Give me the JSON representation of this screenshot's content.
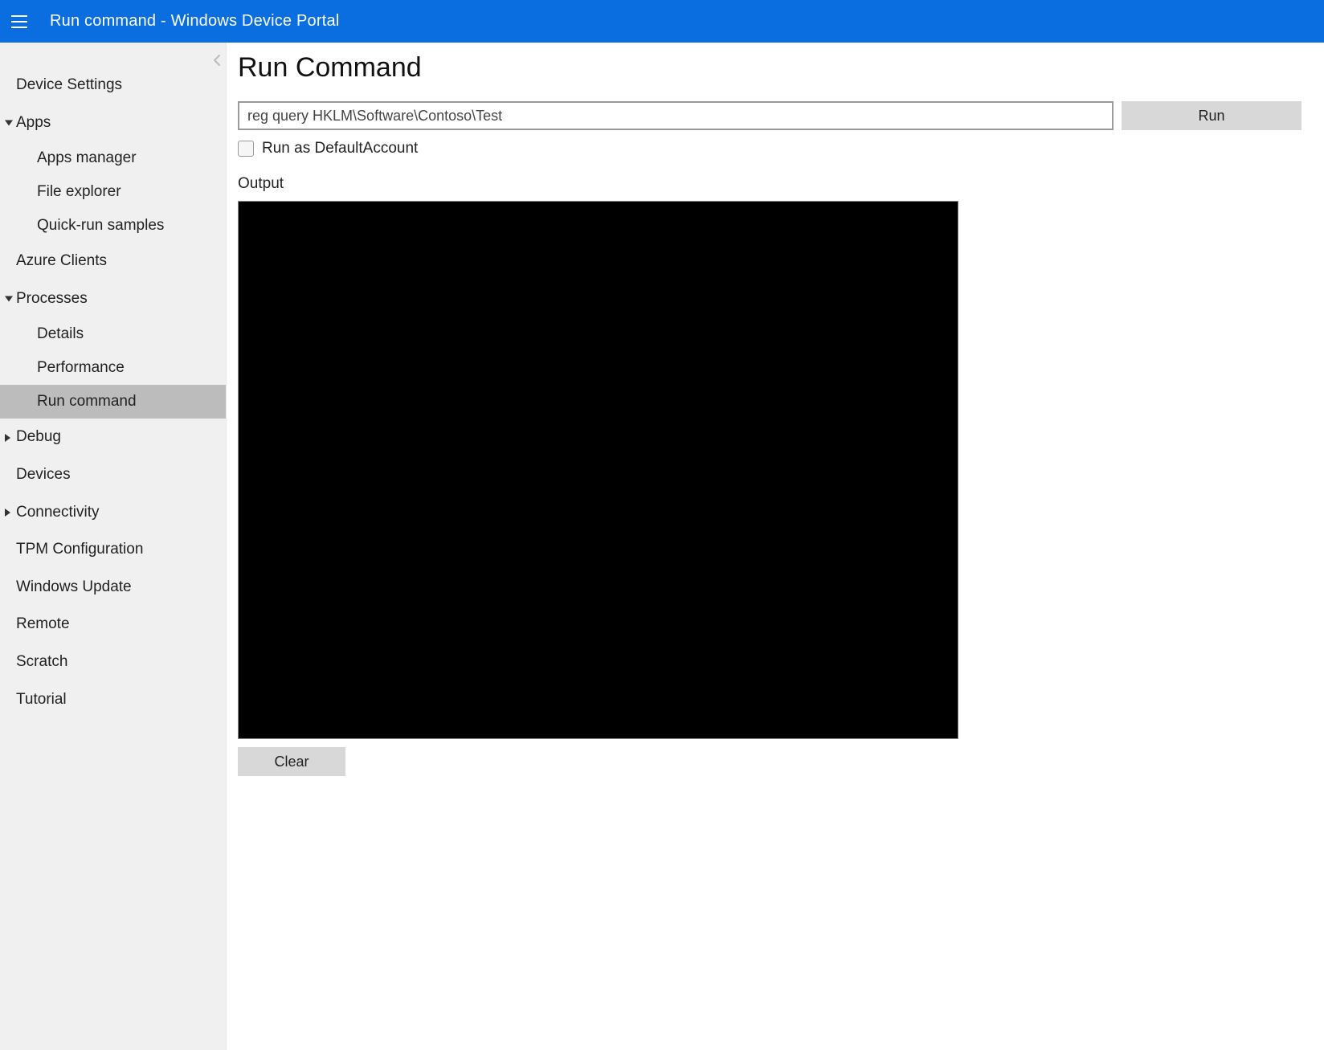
{
  "header": {
    "title": "Run command - Windows Device Portal"
  },
  "sidebar": {
    "items": [
      {
        "label": "Device Settings",
        "type": "item"
      },
      {
        "label": "Apps",
        "type": "group",
        "expanded": true,
        "children": [
          {
            "label": "Apps manager"
          },
          {
            "label": "File explorer"
          },
          {
            "label": "Quick-run samples"
          }
        ]
      },
      {
        "label": "Azure Clients",
        "type": "item"
      },
      {
        "label": "Processes",
        "type": "group",
        "expanded": true,
        "children": [
          {
            "label": "Details"
          },
          {
            "label": "Performance"
          },
          {
            "label": "Run command",
            "selected": true
          }
        ]
      },
      {
        "label": "Debug",
        "type": "group",
        "expanded": false
      },
      {
        "label": "Devices",
        "type": "item"
      },
      {
        "label": "Connectivity",
        "type": "group",
        "expanded": false
      },
      {
        "label": "TPM Configuration",
        "type": "item"
      },
      {
        "label": "Windows Update",
        "type": "item"
      },
      {
        "label": "Remote",
        "type": "item"
      },
      {
        "label": "Scratch",
        "type": "item"
      },
      {
        "label": "Tutorial",
        "type": "item"
      }
    ]
  },
  "main": {
    "title": "Run Command",
    "command_value": "reg query HKLM\\Software\\Contoso\\Test",
    "run_label": "Run",
    "run_as_label": "Run as DefaultAccount",
    "run_as_checked": false,
    "output_heading": "Output",
    "output_text": "",
    "clear_label": "Clear"
  }
}
